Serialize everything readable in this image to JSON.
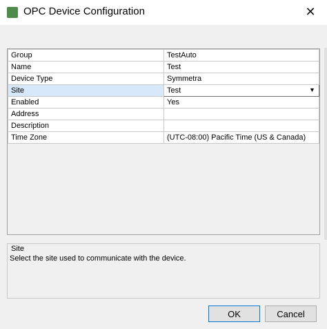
{
  "window": {
    "title": "OPC Device Configuration",
    "close_glyph": "✕"
  },
  "properties": [
    {
      "label": "Group",
      "value": "TestAuto"
    },
    {
      "label": "Name",
      "value": "Test"
    },
    {
      "label": "Device Type",
      "value": "Symmetra"
    },
    {
      "label": "Site",
      "value": "Test",
      "selected": true,
      "editor": "dropdown"
    },
    {
      "label": "Enabled",
      "value": "Yes"
    },
    {
      "label": "Address",
      "value": ""
    },
    {
      "label": "Description",
      "value": ""
    },
    {
      "label": "Time Zone",
      "value": "(UTC-08:00) Pacific Time (US & Canada)"
    }
  ],
  "info_panel": {
    "title": "Site",
    "description": "Select the site used to communicate with the device."
  },
  "buttons": {
    "ok": "OK",
    "cancel": "Cancel"
  },
  "icons": {
    "app": "gear-icon",
    "close": "close-icon",
    "dropdown": "chevron-down-icon"
  }
}
